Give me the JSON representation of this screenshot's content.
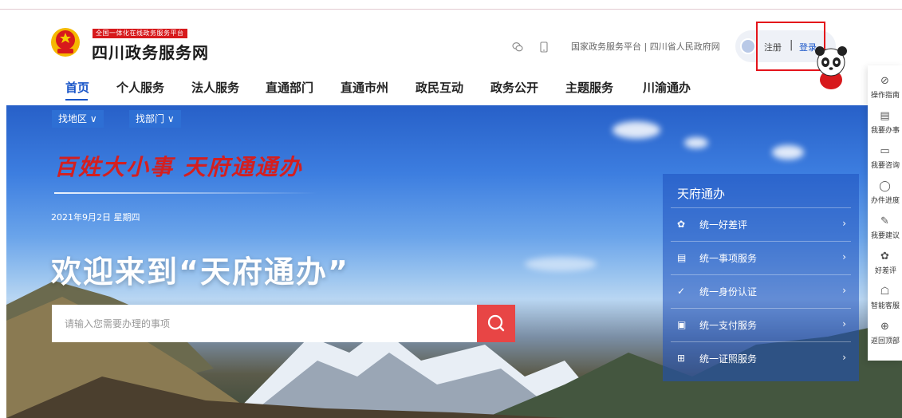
{
  "header": {
    "logo_tag": "全国一体化在线政务服务平台",
    "logo_title": "四川政务服务网",
    "top_links": "国家政务服务平台 | 四川省人民政府网",
    "register": "注册",
    "separator": "|",
    "login": "登录",
    "icons": [
      "wechat-icon",
      "mobile-icon"
    ]
  },
  "nav": {
    "items": [
      {
        "label": "首页",
        "active": true
      },
      {
        "label": "个人服务"
      },
      {
        "label": "法人服务"
      },
      {
        "label": "直通部门"
      },
      {
        "label": "直通市州"
      },
      {
        "label": "政民互动"
      },
      {
        "label": "政务公开"
      },
      {
        "label": "主题服务"
      },
      {
        "label": "川渝通办"
      }
    ]
  },
  "hero": {
    "filters": [
      "找地区 ∨",
      "找部门 ∨"
    ],
    "slogan": "百姓大小事 天府通通办",
    "date": "2021年9月2日 星期四",
    "welcome": "欢迎来到“天府通办”",
    "search_placeholder": "请输入您需要办理的事项"
  },
  "panel": {
    "title": "天府通办",
    "items": [
      {
        "label": "统一好差评",
        "icon": "badge-icon"
      },
      {
        "label": "统一事项服务",
        "icon": "document-icon"
      },
      {
        "label": "统一身份认证",
        "icon": "shield-check-icon"
      },
      {
        "label": "统一支付服务",
        "icon": "payment-icon"
      },
      {
        "label": "统一证照服务",
        "icon": "license-icon"
      }
    ],
    "arrow": "›"
  },
  "toolbar": {
    "items": [
      {
        "label": "操作指南",
        "icon": "compass-icon"
      },
      {
        "label": "我要办事",
        "icon": "form-icon"
      },
      {
        "label": "我要咨询",
        "icon": "chat-icon"
      },
      {
        "label": "办件进度",
        "icon": "progress-icon"
      },
      {
        "label": "我要建议",
        "icon": "suggest-icon"
      },
      {
        "label": "好差评",
        "icon": "rating-icon"
      },
      {
        "label": "智能客服",
        "icon": "robot-icon"
      },
      {
        "label": "返回顶部",
        "icon": "back-to-top-icon"
      }
    ]
  },
  "colors": {
    "accent": "#1a56c8",
    "brand_red": "#d7191c",
    "search_button": "#e84545",
    "highlight_box": "#e4141b"
  }
}
